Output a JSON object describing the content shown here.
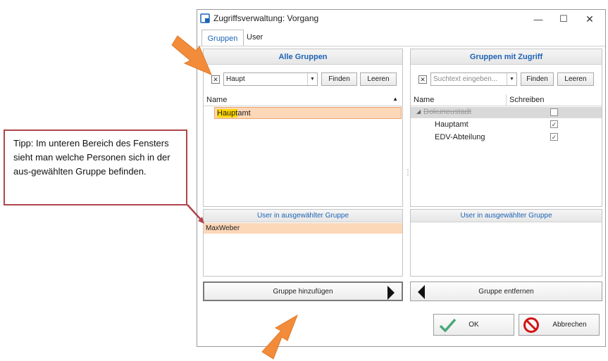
{
  "window": {
    "title": "Zugriffsverwaltung: Vorgang",
    "min": "—",
    "max": "☐",
    "close": "✕"
  },
  "tabs": [
    {
      "label": "Gruppen",
      "active": true
    },
    {
      "label": "User",
      "active": false
    }
  ],
  "left_panel": {
    "header": "Alle Gruppen",
    "search_value": "Haupt",
    "find_label": "Finden",
    "clear_label": "Leeren",
    "col_name": "Name",
    "rows": [
      {
        "name_highlight": "Haupt",
        "name_rest": "amt"
      }
    ],
    "users_header": "User in ausgewählter Gruppe",
    "users": [
      "MaxWeber"
    ],
    "add_button": "Gruppe hinzufügen"
  },
  "right_panel": {
    "header": "Gruppen mit Zugriff",
    "search_placeholder": "Suchtext eingeben...",
    "find_label": "Finden",
    "clear_label": "Leeren",
    "col_name": "Name",
    "col_write": "Schreiben",
    "rows": [
      {
        "name": "Dokuneustadt",
        "checked": false
      },
      {
        "name": "Hauptamt",
        "checked": true
      },
      {
        "name": "EDV-Abteilung",
        "checked": true
      }
    ],
    "users_header": "User in ausgewählter Gruppe",
    "remove_button": "Gruppe entfernen"
  },
  "footer": {
    "ok_label": "OK",
    "cancel_label": "Abbrechen"
  },
  "callout": {
    "text": "Tipp: Im unteren Bereich des Fensters sieht man welche Personen sich in der aus-gewählten Gruppe befinden."
  },
  "colors": {
    "accent": "#1e63b6",
    "selection": "#fcd7b8",
    "highlight": "#ffd700",
    "arrow": "#f28c3a",
    "callout_border": "#b0464a"
  }
}
